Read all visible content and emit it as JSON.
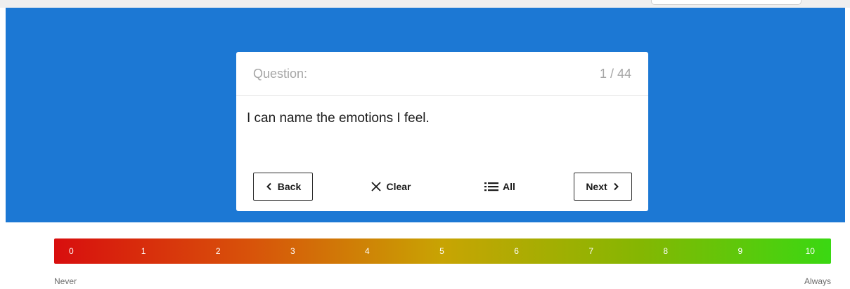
{
  "question": {
    "label": "Question:",
    "counter": "1 / 44",
    "text": "I can name the emotions I feel."
  },
  "buttons": {
    "back": "Back",
    "clear": "Clear",
    "all": "All",
    "next": "Next"
  },
  "scale": {
    "values": [
      "0",
      "1",
      "2",
      "3",
      "4",
      "5",
      "6",
      "7",
      "8",
      "9",
      "10"
    ],
    "min_label": "Never",
    "max_label": "Always",
    "colors": {
      "start": "#d80e0e",
      "end": "#3ad812"
    }
  },
  "colors": {
    "hero": "#1c78d4"
  },
  "icons": {
    "back": "chevron-left-icon",
    "clear": "close-icon",
    "all": "list-icon",
    "next": "chevron-right-icon"
  }
}
